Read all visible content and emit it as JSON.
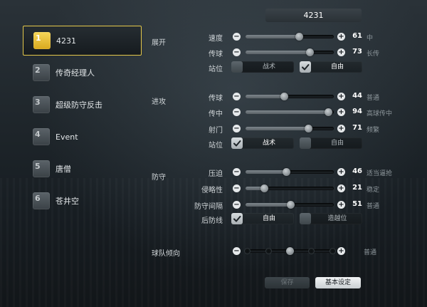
{
  "title": "4231",
  "teams": [
    {
      "num": "1",
      "name": "4231"
    },
    {
      "num": "2",
      "name": "传奇经理人"
    },
    {
      "num": "3",
      "name": "超级防守反击"
    },
    {
      "num": "4",
      "name": "Event"
    },
    {
      "num": "5",
      "name": "唐僧"
    },
    {
      "num": "6",
      "name": "苍井空"
    }
  ],
  "active_team_index": 0,
  "sections": {
    "buildup": "展开",
    "attack": "进攻",
    "defense": "防守",
    "tendency": "球队倾向"
  },
  "buildup": {
    "speed": {
      "label": "速度",
      "value": "61",
      "desc": "中",
      "fraction": 0.61
    },
    "passing": {
      "label": "传球",
      "value": "73",
      "desc": "长传",
      "fraction": 0.73
    },
    "positioning": {
      "label": "站位",
      "option_a": "战术",
      "option_b": "自由",
      "selected": "b"
    }
  },
  "attack": {
    "passing": {
      "label": "传球",
      "value": "44",
      "desc": "普通",
      "fraction": 0.44
    },
    "crossing": {
      "label": "传中",
      "value": "94",
      "desc": "高球传中",
      "fraction": 0.94
    },
    "shooting": {
      "label": "射门",
      "value": "71",
      "desc": "频繁",
      "fraction": 0.71
    },
    "positioning": {
      "label": "站位",
      "option_a": "战术",
      "option_b": "自由",
      "selected": "a"
    }
  },
  "defense": {
    "pressure": {
      "label": "压迫",
      "value": "46",
      "desc": "适当逼抢",
      "fraction": 0.46
    },
    "aggression": {
      "label": "侵略性",
      "value": "21",
      "desc": "稳定",
      "fraction": 0.21
    },
    "width": {
      "label": "防守间隔",
      "value": "51",
      "desc": "普通",
      "fraction": 0.51
    },
    "line": {
      "label": "后防线",
      "option_a": "自由",
      "option_b": "造越位",
      "selected": "a"
    }
  },
  "tendency": {
    "desc": "普通",
    "level": 3,
    "steps": 5
  },
  "buttons": {
    "save": "保存",
    "basic": "基本设定"
  },
  "icons": {
    "minus": "−",
    "plus": "+"
  }
}
